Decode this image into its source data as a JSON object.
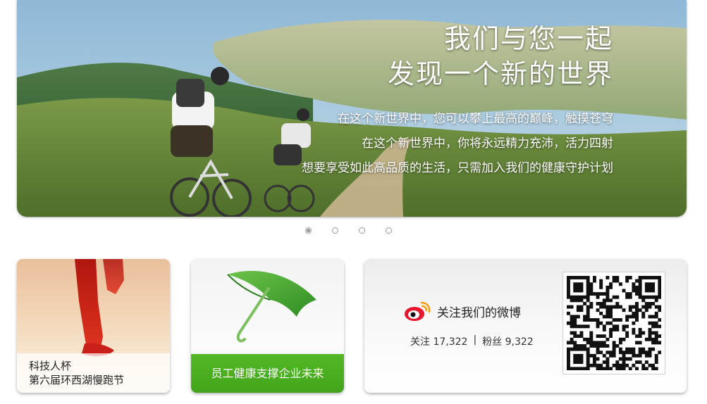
{
  "hero": {
    "headline_1": "我们与您一起",
    "headline_2": "发现一个新的世界",
    "lines": [
      "在这个新世界中，您可以攀上最高的巅峰，触摸苍穹",
      "在这个新世界中，你将永远精力充沛，活力四射",
      "想要享受如此高品质的生活，只需加入我们的健康守护计划"
    ]
  },
  "slider": {
    "count": 4,
    "active_index": 0
  },
  "cards": {
    "run": {
      "line_1": "科技人杯",
      "line_2": "第六届环西湖慢跑节"
    },
    "umbrella": {
      "label": "员工健康支撑企业未来"
    },
    "weibo": {
      "title": "关注我们的微博",
      "follow_label": "关注 17,322",
      "divider": "|",
      "fans_label": "粉丝 9,322",
      "icon": "weibo-logo-icon"
    }
  },
  "colors": {
    "green": "#4cb322",
    "weibo_red": "#e6162d"
  }
}
